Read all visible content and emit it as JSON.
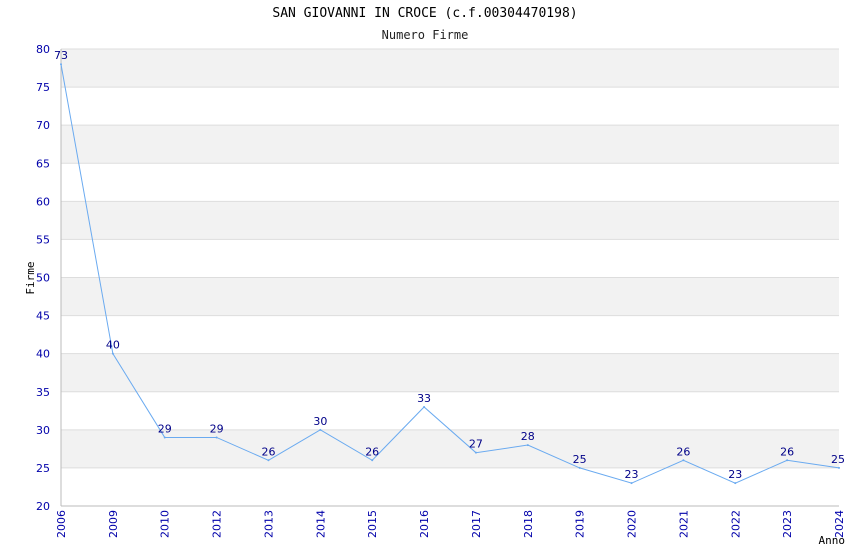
{
  "chart_data": {
    "type": "line",
    "title": "SAN GIOVANNI IN CROCE (c.f.00304470198)",
    "subtitle": "Numero Firme",
    "xlabel": "Anno",
    "ylabel": "Firme",
    "categories": [
      "2006",
      "2009",
      "2010",
      "2012",
      "2013",
      "2014",
      "2015",
      "2016",
      "2017",
      "2018",
      "2019",
      "2020",
      "2021",
      "2022",
      "2023",
      "2024"
    ],
    "values": [
      78,
      40,
      29,
      29,
      26,
      30,
      26,
      33,
      27,
      28,
      25,
      23,
      26,
      23,
      26,
      25
    ],
    "data_labels": [
      "73",
      "40",
      "29",
      "29",
      "26",
      "30",
      "26",
      "33",
      "27",
      "28",
      "25",
      "23",
      "26",
      "23",
      "26",
      "25"
    ],
    "ylim": [
      20,
      80
    ],
    "yticks": [
      "20",
      "25",
      "30",
      "35",
      "40",
      "45",
      "50",
      "55",
      "60",
      "65",
      "70",
      "75",
      "80"
    ],
    "grid": true,
    "colors": {
      "line": "#6aaaf0",
      "band": "#f2f2f2",
      "grid": "#dddddd",
      "tick_text": "#0000aa",
      "label_text": "#000088"
    }
  }
}
